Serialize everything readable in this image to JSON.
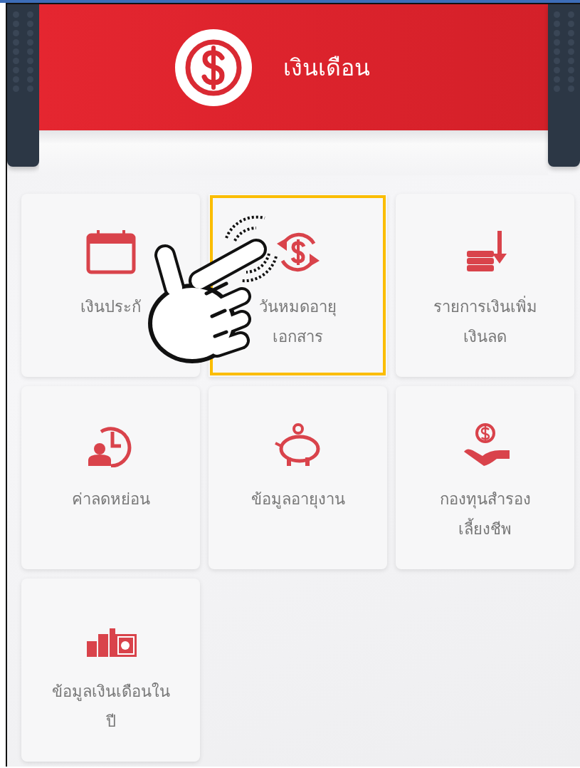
{
  "header": {
    "title": "เงินเดือน"
  },
  "menu_items": [
    {
      "lines": [
        "เงินประกั"
      ],
      "selected": false
    },
    {
      "lines": [
        "วันหมดอายุ",
        "เอกสาร"
      ],
      "selected": true
    },
    {
      "lines": [
        "รายการเงินเพิ่ม",
        "เงินลด"
      ],
      "selected": false
    },
    {
      "lines": [
        "ค่าลดหย่อน"
      ],
      "selected": false
    },
    {
      "lines": [
        "ข้อมูลอายุงาน"
      ],
      "selected": false
    },
    {
      "lines": [
        "กองทุนสำรอง",
        "เลี้ยงชีพ"
      ],
      "selected": false
    },
    {
      "lines": [
        "ข้อมูลเงินเดือนใน",
        "ปี"
      ],
      "selected": false
    }
  ]
}
